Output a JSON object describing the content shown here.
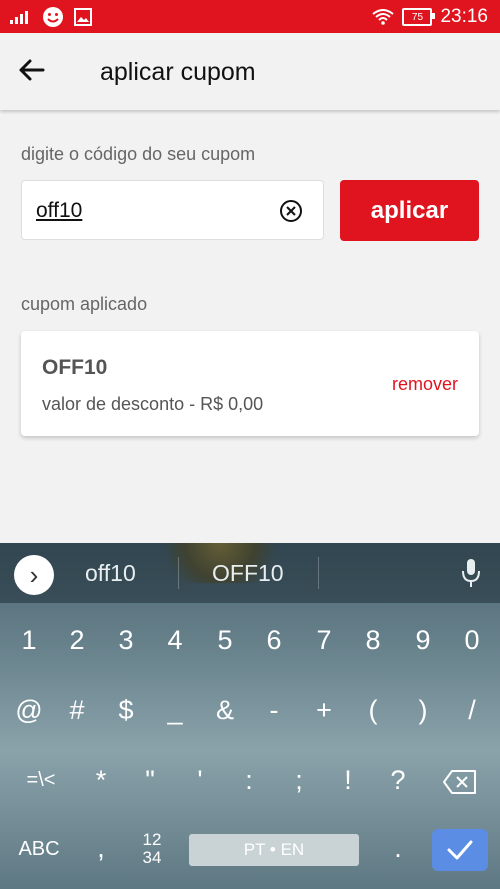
{
  "status": {
    "time": "23:16",
    "battery": "75"
  },
  "appbar": {
    "title": "aplicar cupom"
  },
  "coupon_input": {
    "label": "digite o código do seu cupom",
    "value": "off10"
  },
  "apply_button": {
    "label": "aplicar"
  },
  "applied": {
    "label": "cupom aplicado",
    "code": "OFF10",
    "discount": "valor de desconto - R$ 0,00",
    "remove_label": "remover"
  },
  "keyboard": {
    "suggestions": [
      "off10",
      "OFF10"
    ],
    "row_numbers": [
      "1",
      "2",
      "3",
      "4",
      "5",
      "6",
      "7",
      "8",
      "9",
      "0"
    ],
    "row_symbols1": [
      "@",
      "#",
      "$",
      "_",
      "&",
      "-",
      "+",
      "(",
      ")",
      "/"
    ],
    "row_symbols2": [
      "=\\<",
      "*",
      "\"",
      "'",
      ":",
      ";",
      "!",
      "?"
    ],
    "abc_label": "ABC",
    "comma": ",",
    "num_label_top": "12",
    "num_label_bottom": "34",
    "space_label": "PT • EN",
    "period": "."
  }
}
